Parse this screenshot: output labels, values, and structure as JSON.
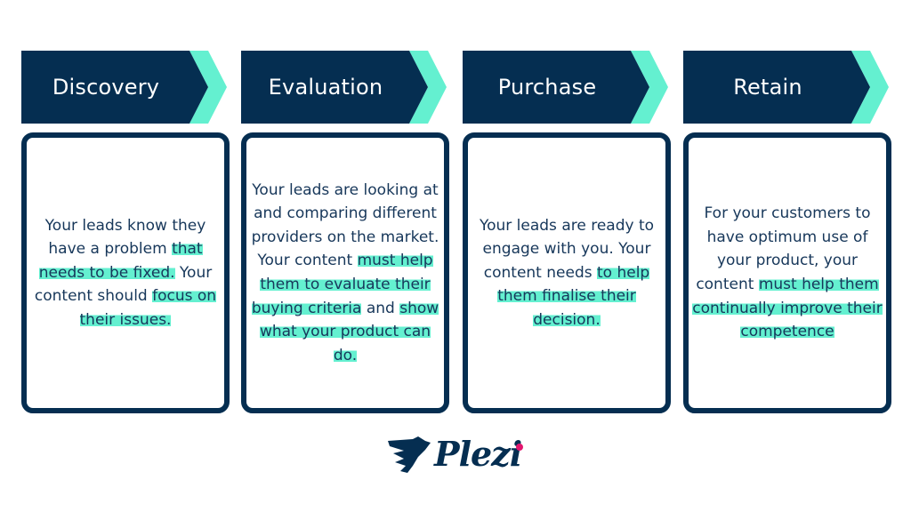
{
  "colors": {
    "navy": "#052E51",
    "teal": "#64F0D0",
    "text": "#17375A",
    "brand_dot": "#E2166F"
  },
  "stages": [
    {
      "title": "Discovery",
      "segments": [
        {
          "text": "Your leads know they have a problem ",
          "highlight": false
        },
        {
          "text": "that needs to be fixed.",
          "highlight": true
        },
        {
          "text": " Your content should ",
          "highlight": false
        },
        {
          "text": "focus on their issues.",
          "highlight": true
        }
      ]
    },
    {
      "title": "Evaluation",
      "segments": [
        {
          "text": "Your leads are looking at and comparing different providers on the market. Your content ",
          "highlight": false
        },
        {
          "text": "must help them to evaluate their buying criteria",
          "highlight": true
        },
        {
          "text": " and ",
          "highlight": false
        },
        {
          "text": "show what your product can do.",
          "highlight": true
        }
      ]
    },
    {
      "title": "Purchase",
      "segments": [
        {
          "text": "Your leads are ready to engage with you. Your content needs ",
          "highlight": false
        },
        {
          "text": "to help them finalise their decision.",
          "highlight": true
        }
      ]
    },
    {
      "title": "Retain",
      "segments": [
        {
          "text": "For your customers to have optimum use of your product, your content ",
          "highlight": false
        },
        {
          "text": "must help them continually improve their competence",
          "highlight": true
        }
      ]
    }
  ],
  "logo": {
    "text": "Plezi",
    "icon": "wing-icon"
  }
}
